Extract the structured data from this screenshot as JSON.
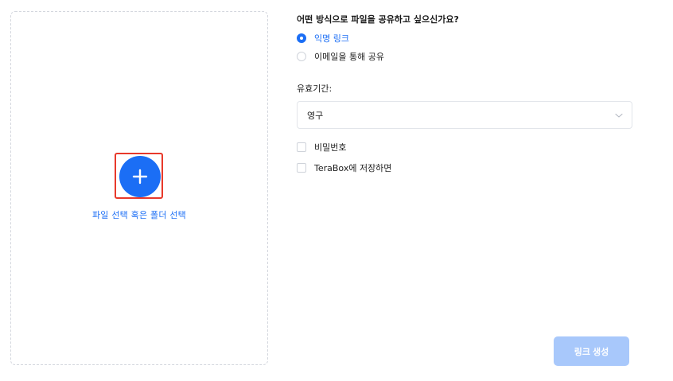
{
  "upload": {
    "select_file_label": "파일 선택",
    "or_label": "혹은",
    "select_folder_label": "폴더 선택"
  },
  "share": {
    "question": "어떤 방식으로 파일을 공유하고 싶으신가요?",
    "options": [
      {
        "label": "익명 링크",
        "checked": true
      },
      {
        "label": "이메일을 통해 공유",
        "checked": false
      }
    ],
    "expiry_label": "유효기간:",
    "expiry_value": "영구",
    "password_label": "비밀번호",
    "save_to_terabox_label": "TeraBox에 저장하면",
    "create_link_label": "링크 생성"
  },
  "colors": {
    "accent": "#1b6ef5",
    "disabled_button": "#a8c8fb",
    "highlight": "#e8392b"
  }
}
